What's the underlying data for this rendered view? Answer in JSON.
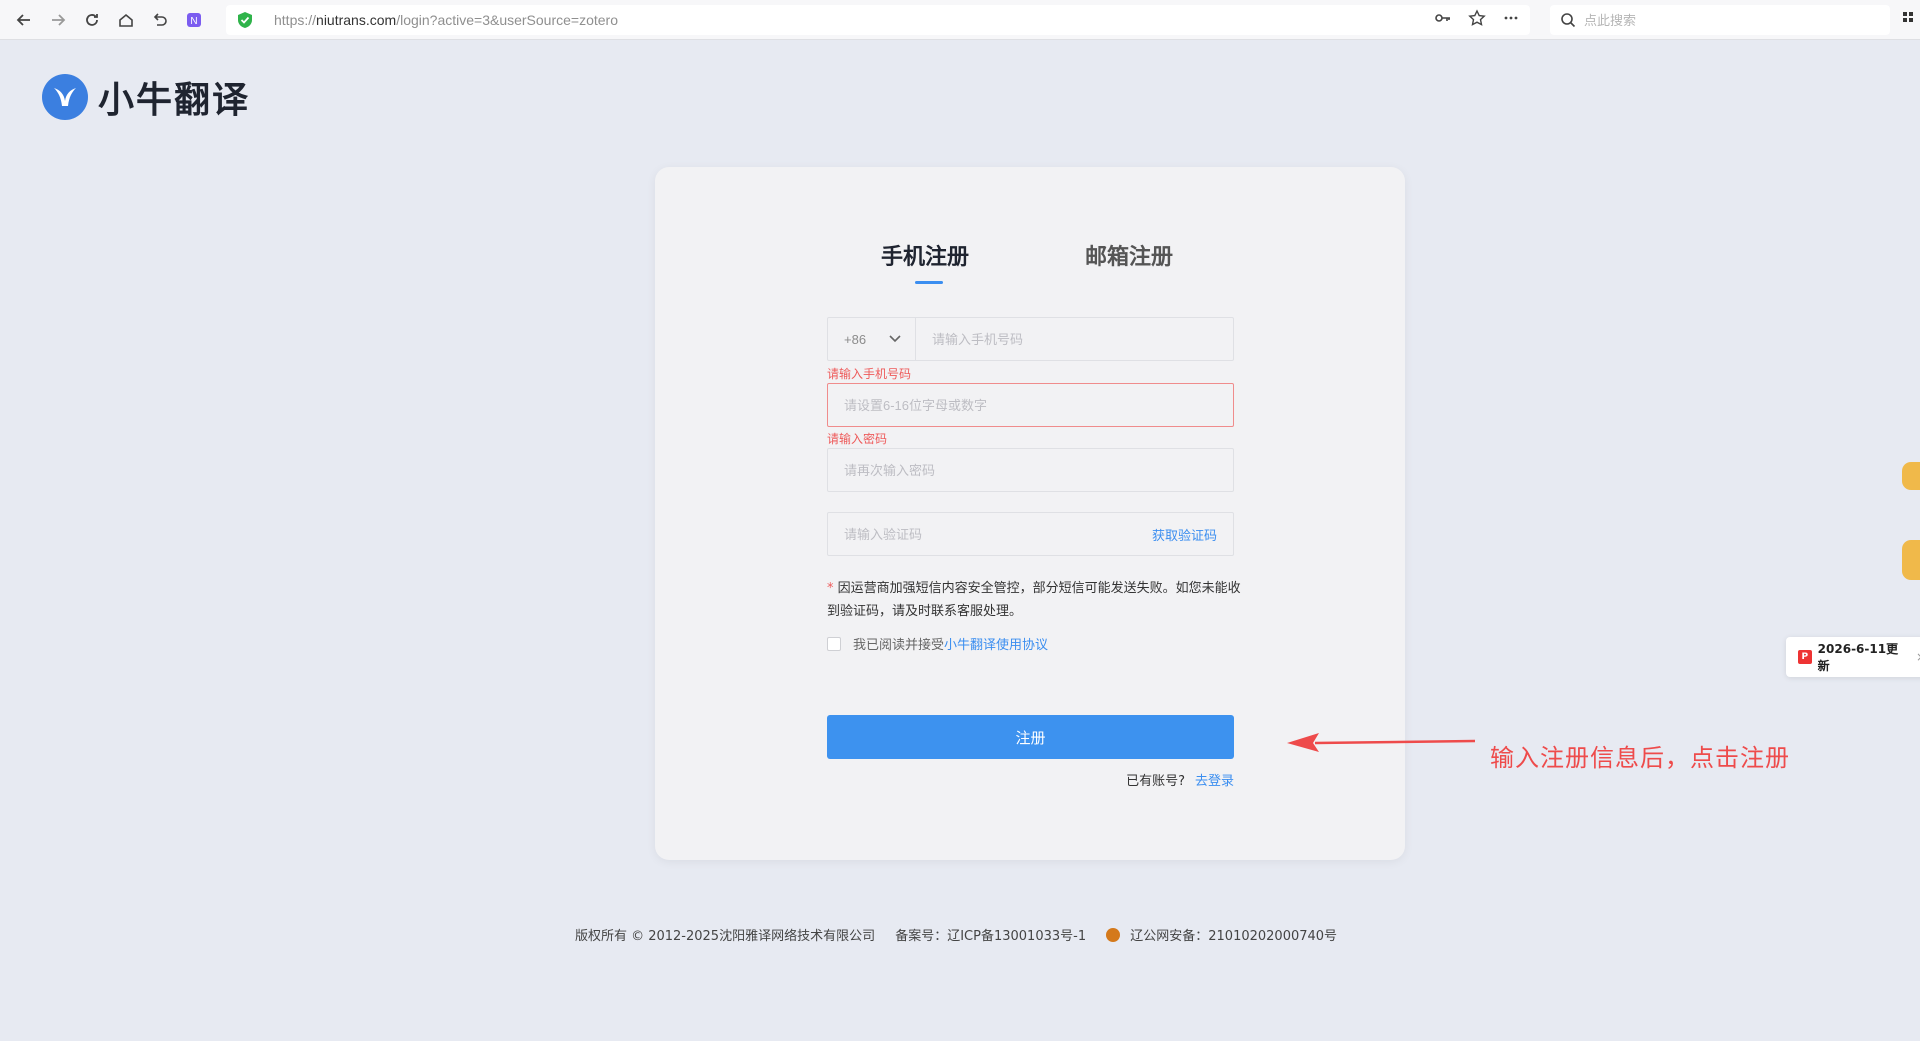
{
  "browser": {
    "url_prefix": "https://",
    "url_domain": "niutrans.com",
    "url_path": "/login?active=3&userSource=zotero",
    "search_placeholder": "点此搜索"
  },
  "logo": {
    "text": "小牛翻译"
  },
  "tabs": {
    "phone": "手机注册",
    "email": "邮箱注册"
  },
  "form": {
    "country_code": "+86",
    "phone_placeholder": "请输入手机号码",
    "phone_error": "请输入手机号码",
    "password_placeholder": "请设置6-16位字母或数字",
    "password_error": "请输入密码",
    "confirm_placeholder": "请再次输入密码",
    "code_placeholder": "请输入验证码",
    "get_code": "获取验证码",
    "notice_star": "*",
    "notice_text": "因运营商加强短信内容安全管控，部分短信可能发送失败。如您未能收到验证码，请及时联系客服处理。",
    "agree_text": "我已阅读并接受",
    "agree_link": "小牛翻译使用协议",
    "register_button": "注册",
    "login_hint": "已有账号?",
    "login_link": "去登录"
  },
  "annotation": {
    "text": "输入注册信息后，点击注册",
    "color": "#ee4b4b"
  },
  "side": {
    "update_badge": "2026-6-11更新",
    "pdf_label": "P",
    "close": "×"
  },
  "footer": {
    "copyright": "版权所有 © 2012-2025沈阳雅译网络技术有限公司",
    "icp": "备案号：辽ICP备13001033号-1",
    "police": "辽公网安备：21010202000740号"
  },
  "colors": {
    "accent": "#3d92ef",
    "error": "#ee5a5a",
    "background": "#e7eaf2"
  }
}
